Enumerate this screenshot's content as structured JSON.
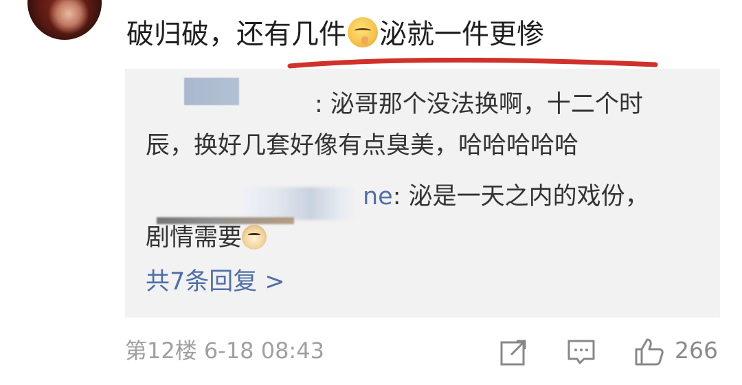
{
  "comment": {
    "text_before_emoji": "破归破，还有几件",
    "emoji_name": "shush-face-emoji",
    "text_after_emoji": "泌就一件更惨"
  },
  "annotation": {
    "underline_color": "#d0322a"
  },
  "replies": [
    {
      "name_suffix": "",
      "line1": ": 泌哥那个没法换啊，十二个时",
      "line2": "辰，换好几套好像有点臭美，哈哈哈哈哈"
    },
    {
      "name_suffix": "ne",
      "line1": ": 泌是一天之内的戏份，",
      "line2": "剧情需要",
      "emoji_name": "doge-emoji"
    }
  ],
  "more_replies": {
    "label": "共7条回复 >"
  },
  "footer": {
    "floor": "第12楼",
    "timestamp": "6-18 08:43",
    "like_count": "266"
  },
  "colors": {
    "link_blue": "#4f6fa8",
    "reply_bg": "#f2f2f2",
    "meta_gray": "#a0a0a0"
  }
}
